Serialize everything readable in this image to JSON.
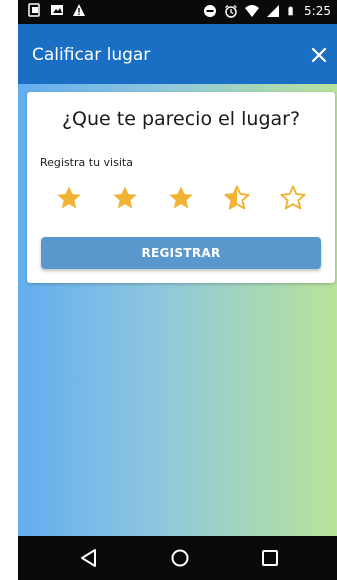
{
  "status_bar": {
    "time": "5:25",
    "left_icons": [
      "notification-icon",
      "image-icon",
      "warning-icon"
    ],
    "right_icons": [
      "do-not-disturb-icon",
      "alarm-icon",
      "wifi-icon",
      "signal-icon",
      "battery-icon"
    ]
  },
  "app_bar": {
    "title": "Calificar lugar",
    "close_icon": "close-icon",
    "color": "#1a6fc4"
  },
  "card": {
    "question": "¿Que te parecio el lugar?",
    "visit_label": "Registra tu visita",
    "rating": 3.5,
    "max_rating": 5,
    "star_color": "#f2b233",
    "button_label": "REGISTRAR",
    "button_color": "#5a97cc"
  },
  "nav_bar": {
    "buttons": [
      "back-icon",
      "home-icon",
      "recents-icon"
    ]
  }
}
